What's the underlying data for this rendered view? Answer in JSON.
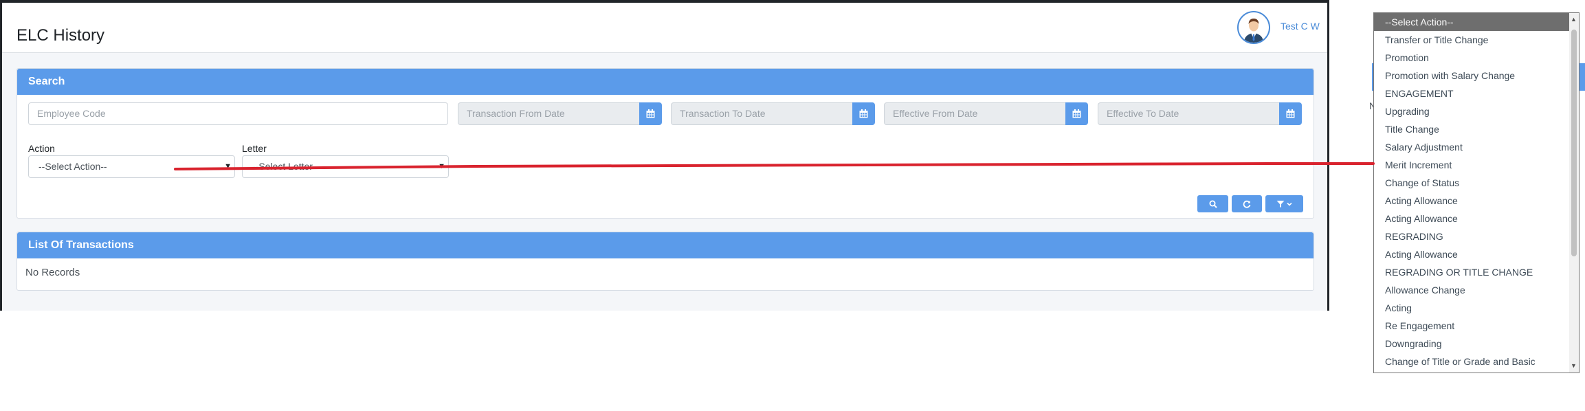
{
  "page": {
    "title": "ELC History",
    "user_name": "Test C W"
  },
  "search_card": {
    "title": "Search",
    "employee_code_placeholder": "Employee Code",
    "transaction_from_placeholder": "Transaction From Date",
    "transaction_to_placeholder": "Transaction To Date",
    "effective_from_placeholder": "Effective From Date",
    "effective_to_placeholder": "Effective To Date",
    "action_label": "Action",
    "action_value": "--Select Action--",
    "letter_label": "Letter",
    "letter_value": "--Select Letter--"
  },
  "list_card": {
    "title": "List Of Transactions",
    "empty_text": "No Records"
  },
  "dropdown": {
    "options": [
      "--Select Action--",
      "Transfer or Title Change",
      "Promotion",
      "Promotion with Salary Change",
      "ENGAGEMENT",
      "Upgrading",
      "Title Change",
      "Salary Adjustment",
      "Merit Increment",
      "Change of Status",
      "Acting Allowance",
      "Acting Allowance",
      "REGRADING",
      "Acting Allowance",
      "REGRADING OR TITLE CHANGE",
      "Allowance Change",
      "Acting",
      "Re Engagement",
      "Downgrading",
      "Change of Title or Grade and Basic"
    ],
    "selected_index": 0
  },
  "colors": {
    "accent": "#5b9bea",
    "annotation": "#d9232e",
    "user_link": "#4a8bd8"
  },
  "icons": [
    "calendar-icon",
    "search-icon",
    "refresh-icon",
    "filter-icon",
    "chevron-down-icon",
    "user-avatar"
  ]
}
